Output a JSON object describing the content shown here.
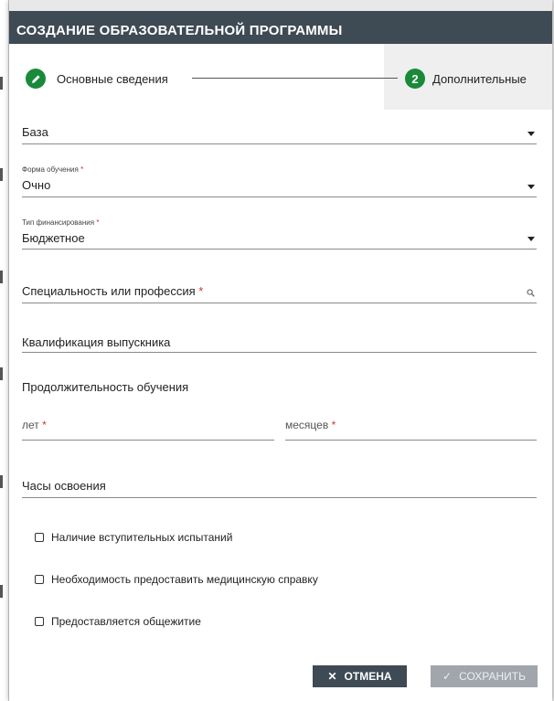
{
  "dialog": {
    "title": "СОЗДАНИЕ ОБРАЗОВАТЕЛЬНОЙ ПРОГРАММЫ"
  },
  "stepper": {
    "step1": {
      "label": "Основные сведения",
      "status": "completed",
      "icon": "pencil-icon"
    },
    "step2": {
      "number": "2",
      "label": "Дополнительные",
      "status": "active"
    }
  },
  "form": {
    "base": {
      "value": "База"
    },
    "study_form": {
      "label": "Форма обучения",
      "required_mark": "*",
      "value": "Очно"
    },
    "funding": {
      "label": "Тип финансирования",
      "required_mark": "*",
      "value": "Бюджетное"
    },
    "specialty": {
      "placeholder": "Специальность или профессия",
      "required_mark": "*"
    },
    "qualification": {
      "placeholder": "Квалификация выпускника"
    },
    "duration": {
      "heading": "Продолжительность обучения",
      "years": {
        "placeholder": "лет",
        "required_mark": "*"
      },
      "months": {
        "placeholder": "месяцев",
        "required_mark": "*"
      }
    },
    "hours": {
      "placeholder": "Часы освоения"
    },
    "checkboxes": [
      {
        "label": "Наличие вступительных испытаний",
        "checked": false
      },
      {
        "label": "Необходимость предоставить медицинскую справку",
        "checked": false
      },
      {
        "label": "Предоставляется общежитие",
        "checked": false
      }
    ]
  },
  "actions": {
    "cancel_label": "ОТМЕНА",
    "save_label": "СОХРАНИТЬ"
  },
  "colors": {
    "header": "#3e4a54",
    "step_active": "#1a8a3a",
    "required": "#d0342c",
    "save_disabled": "#a0a6ab"
  }
}
